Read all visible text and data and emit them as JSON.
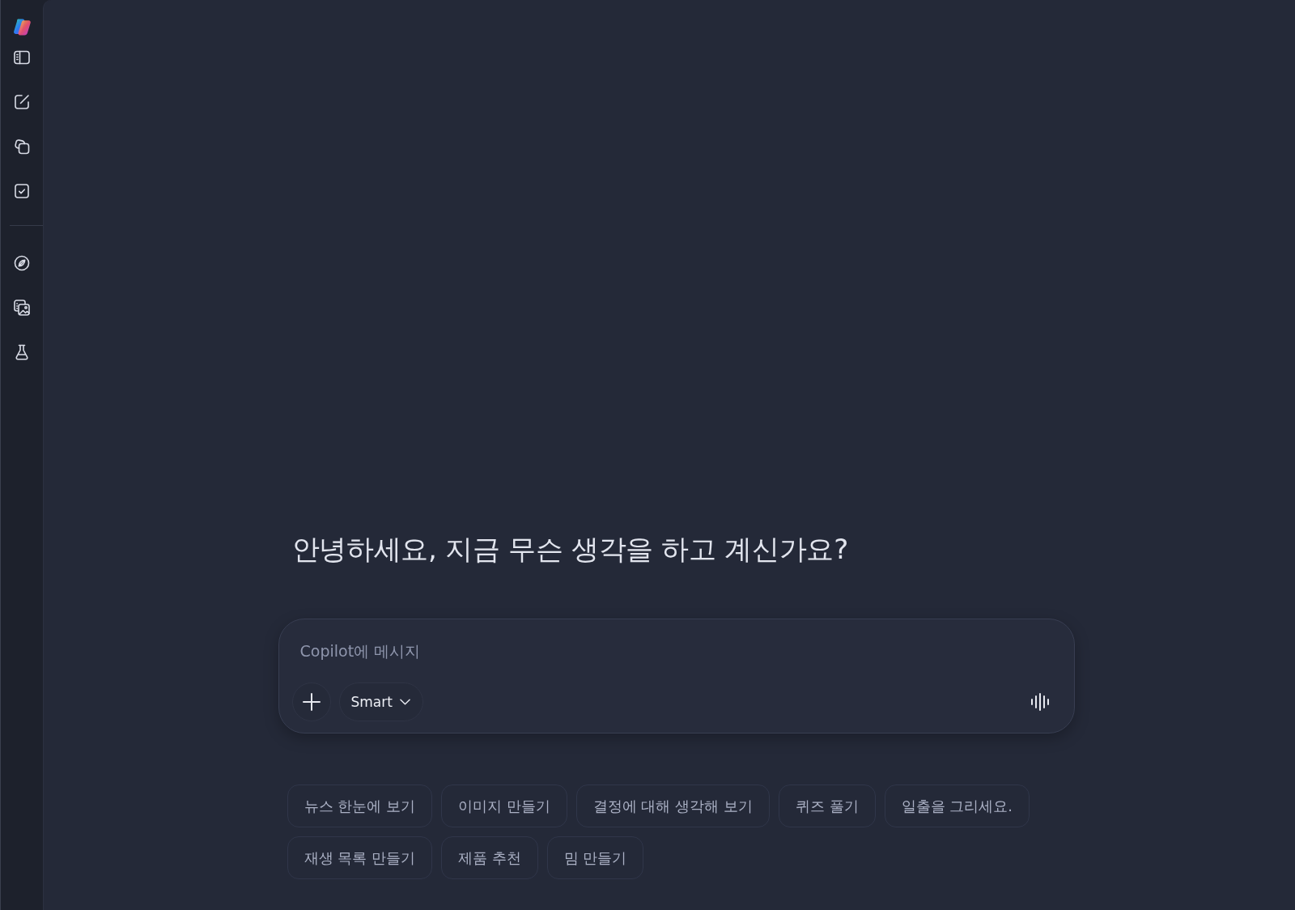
{
  "greeting": "안녕하세요, 지금 무슨 생각을 하고 계신가요?",
  "composer": {
    "placeholder": "Copilot에 메시지",
    "mode_button": {
      "label": "Smart"
    }
  },
  "suggestions": [
    {
      "label": "뉴스 한눈에 보기"
    },
    {
      "label": "이미지 만들기"
    },
    {
      "label": "결정에 대해 생각해 보기"
    },
    {
      "label": "퀴즈 풀기"
    },
    {
      "label": "일출을 그리세요."
    },
    {
      "label": "재생 목록 만들기"
    },
    {
      "label": "제품 추천"
    },
    {
      "label": "밈 만들기"
    }
  ]
}
